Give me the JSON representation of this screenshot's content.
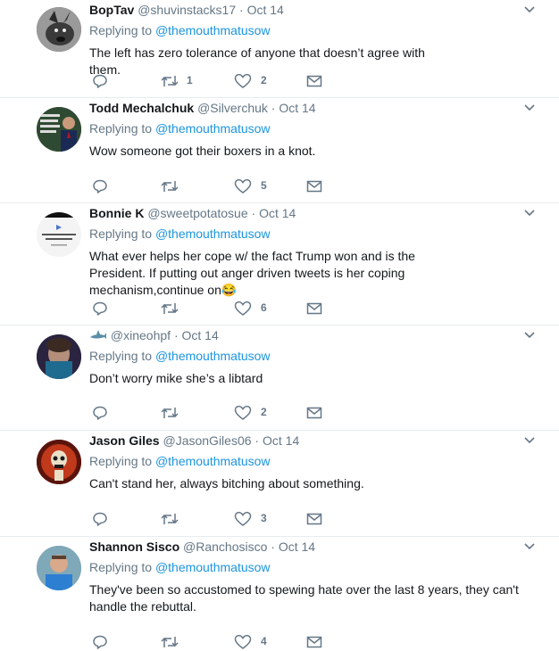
{
  "reply_prefix": "Replying to",
  "tweets": [
    {
      "fullname": "BopTav",
      "handle": "@shuvinstacks17",
      "dot": "·",
      "time": "Oct 14",
      "replying_to": "@themouthmatusow",
      "text": "The left has zero tolerance of anyone that doesn’t agree with them.",
      "retweets": "1",
      "likes": "2",
      "avatar_color": "#5a5a5a"
    },
    {
      "fullname": "Todd Mechalchuk",
      "handle": "@Silverchuk",
      "dot": "·",
      "time": "Oct 14",
      "replying_to": "@themouthmatusow",
      "text": "Wow someone got their boxers in a knot.",
      "retweets": "",
      "likes": "5",
      "avatar_color": "#2f4a32",
      "avatar_caption": "I do not Condone..."
    },
    {
      "fullname": "Bonnie K",
      "handle": "@sweetpotatosue",
      "dot": "·",
      "time": "Oct 14",
      "replying_to": "@themouthmatusow",
      "text": "What ever helps her cope w/ the fact Trump won and is the President. If putting out anger driven tweets is her coping mechanism,continue on😂",
      "retweets": "",
      "likes": "6",
      "avatar_color": "#f4f4f4",
      "avatar_caption": "Marked Safe From Harvey Weinstein"
    },
    {
      "fullname": "",
      "handle": "@xineohpf",
      "dot": "·",
      "time": "Oct 14",
      "replying_to": "@themouthmatusow",
      "text": "Don’t worry mike she’s a libtard",
      "retweets": "",
      "likes": "2",
      "avatar_color": "#3b3450"
    },
    {
      "fullname": "Jason Giles",
      "handle": "@JasonGiles06",
      "dot": "·",
      "time": "Oct 14",
      "replying_to": "@themouthmatusow",
      "text": "Can't stand her, always bitching about something.",
      "retweets": "",
      "likes": "3",
      "avatar_color": "#7a1e12"
    },
    {
      "fullname": "Shannon Sisco",
      "handle": "@Ranchosisco",
      "dot": "·",
      "time": "Oct 14",
      "replying_to": "@themouthmatusow",
      "text": "They've been so accustomed to spewing hate over the last 8 years, they can't handle the rebuttal.",
      "retweets": "",
      "likes": "4",
      "avatar_color": "#6f8fa0"
    }
  ],
  "colors": {
    "link": "#1b95e0",
    "muted": "#657786",
    "border": "#e6ecf0",
    "icon": "#657786"
  }
}
